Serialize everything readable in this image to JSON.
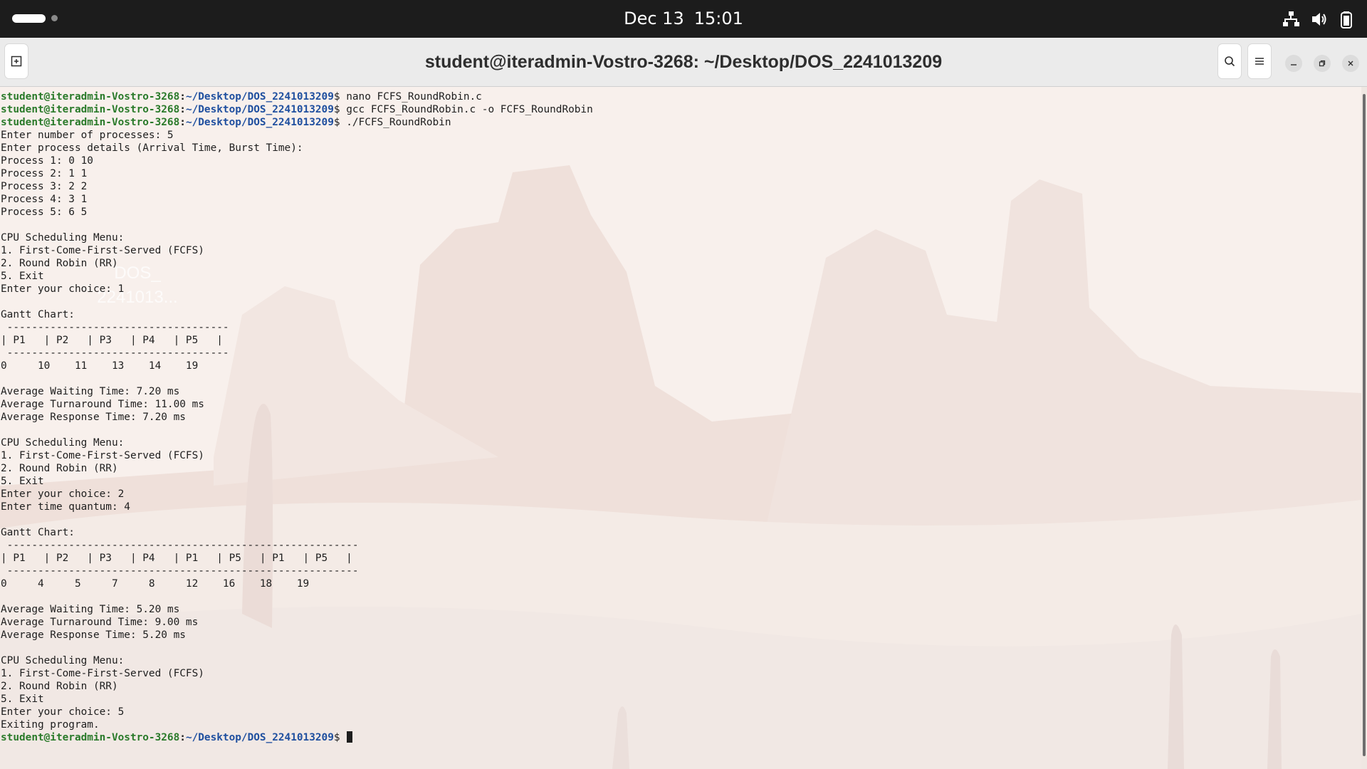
{
  "topbar": {
    "date": "Dec 13",
    "time": "15:01",
    "icons": [
      "workspace-indicator-icon",
      "network-icon",
      "volume-icon",
      "battery-icon"
    ]
  },
  "window": {
    "title": "student@iteradmin-Vostro-3268: ~/Desktop/DOS_2241013209",
    "new_tab_icon": "new-tab-icon",
    "search_icon": "search-icon",
    "menu_icon": "hamburger-menu-icon"
  },
  "desktop": {
    "folder_label_line1": "DOS_",
    "folder_label_line2": "2241013..."
  },
  "terminal": {
    "prompt_user": "student@iteradmin-Vostro-3268",
    "prompt_path": "~/Desktop/DOS_2241013209",
    "lines": [
      {
        "type": "cmd",
        "text": "nano FCFS_RoundRobin.c"
      },
      {
        "type": "cmd",
        "text": "gcc FCFS_RoundRobin.c -o FCFS_RoundRobin"
      },
      {
        "type": "cmd",
        "text": "./FCFS_RoundRobin"
      },
      {
        "type": "out",
        "text": "Enter number of processes: 5"
      },
      {
        "type": "out",
        "text": "Enter process details (Arrival Time, Burst Time):"
      },
      {
        "type": "out",
        "text": "Process 1: 0 10"
      },
      {
        "type": "out",
        "text": "Process 2: 1 1"
      },
      {
        "type": "out",
        "text": "Process 3: 2 2"
      },
      {
        "type": "out",
        "text": "Process 4: 3 1"
      },
      {
        "type": "out",
        "text": "Process 5: 6 5"
      },
      {
        "type": "out",
        "text": ""
      },
      {
        "type": "out",
        "text": "CPU Scheduling Menu:"
      },
      {
        "type": "out",
        "text": "1. First-Come-First-Served (FCFS)"
      },
      {
        "type": "out",
        "text": "2. Round Robin (RR)"
      },
      {
        "type": "out",
        "text": "5. Exit"
      },
      {
        "type": "out",
        "text": "Enter your choice: 1"
      },
      {
        "type": "out",
        "text": ""
      },
      {
        "type": "out",
        "text": "Gantt Chart:"
      },
      {
        "type": "out",
        "text": " ------------------------------------"
      },
      {
        "type": "out",
        "text": "| P1   | P2   | P3   | P4   | P5   |"
      },
      {
        "type": "out",
        "text": " ------------------------------------"
      },
      {
        "type": "out",
        "text": "0     10    11    13    14    19"
      },
      {
        "type": "out",
        "text": ""
      },
      {
        "type": "out",
        "text": "Average Waiting Time: 7.20 ms"
      },
      {
        "type": "out",
        "text": "Average Turnaround Time: 11.00 ms"
      },
      {
        "type": "out",
        "text": "Average Response Time: 7.20 ms"
      },
      {
        "type": "out",
        "text": ""
      },
      {
        "type": "out",
        "text": "CPU Scheduling Menu:"
      },
      {
        "type": "out",
        "text": "1. First-Come-First-Served (FCFS)"
      },
      {
        "type": "out",
        "text": "2. Round Robin (RR)"
      },
      {
        "type": "out",
        "text": "5. Exit"
      },
      {
        "type": "out",
        "text": "Enter your choice: 2"
      },
      {
        "type": "out",
        "text": "Enter time quantum: 4"
      },
      {
        "type": "out",
        "text": ""
      },
      {
        "type": "out",
        "text": "Gantt Chart:"
      },
      {
        "type": "out",
        "text": " ---------------------------------------------------------"
      },
      {
        "type": "out",
        "text": "| P1   | P2   | P3   | P4   | P1   | P5   | P1   | P5   |"
      },
      {
        "type": "out",
        "text": " ---------------------------------------------------------"
      },
      {
        "type": "out",
        "text": "0     4     5     7     8     12    16    18    19"
      },
      {
        "type": "out",
        "text": ""
      },
      {
        "type": "out",
        "text": "Average Waiting Time: 5.20 ms"
      },
      {
        "type": "out",
        "text": "Average Turnaround Time: 9.00 ms"
      },
      {
        "type": "out",
        "text": "Average Response Time: 5.20 ms"
      },
      {
        "type": "out",
        "text": ""
      },
      {
        "type": "out",
        "text": "CPU Scheduling Menu:"
      },
      {
        "type": "out",
        "text": "1. First-Come-First-Served (FCFS)"
      },
      {
        "type": "out",
        "text": "2. Round Robin (RR)"
      },
      {
        "type": "out",
        "text": "5. Exit"
      },
      {
        "type": "out",
        "text": "Enter your choice: 5"
      },
      {
        "type": "out",
        "text": "Exiting program."
      },
      {
        "type": "prompt",
        "text": ""
      }
    ]
  },
  "colors": {
    "prompt_user": "#2a7a2a",
    "prompt_path": "#1f4f9f",
    "text": "#1e1e1e",
    "topbar_bg": "#1c1c1c"
  }
}
